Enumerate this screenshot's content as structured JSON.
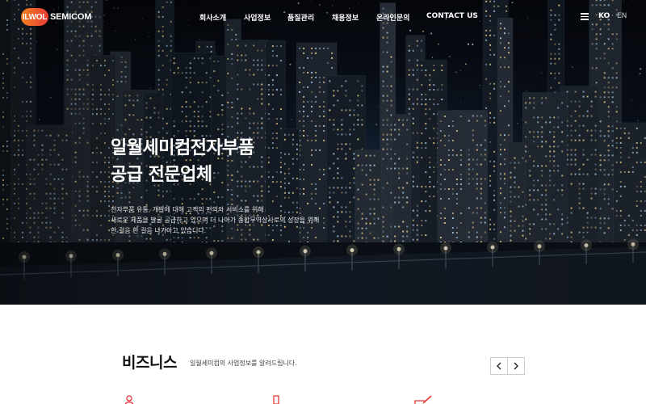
{
  "header": {
    "logo_mark": "ILWOL",
    "logo_text": "SEMICOM",
    "nav": [
      "회사소개",
      "사업정보",
      "품질관리",
      "채용정보",
      "온라인문의",
      "CONTACT US"
    ],
    "lang_ko": "KO",
    "lang_sep": "·",
    "lang_en": "EN",
    "menu_icon": "hamburger-icon"
  },
  "hero": {
    "title_line1": "일월세미컴전자부품",
    "title_line2": "공급 전문업체",
    "desc_line1": "전자부품 유통, 개발에 대해 고객의 편의와 서비스를 위해",
    "desc_line2": "새로운 제품을 발굴 공급하고 있으며 더 나아가 종합무역상사로의 성장을 위해",
    "desc_line3": "한 걸음 한 걸음 나가아고 있습니다."
  },
  "business": {
    "title": "비즈니스",
    "subtitle": "일월세미컴의 사업정보를 알려드립니다.",
    "prev_icon": "chevron-left-icon",
    "next_icon": "chevron-right-icon",
    "icons": [
      "person-icon",
      "flask-icon",
      "pen-icon"
    ]
  },
  "colors": {
    "brand_orange": "#f58220",
    "brand_red": "#e53935",
    "icon_accent": "#e53935"
  }
}
